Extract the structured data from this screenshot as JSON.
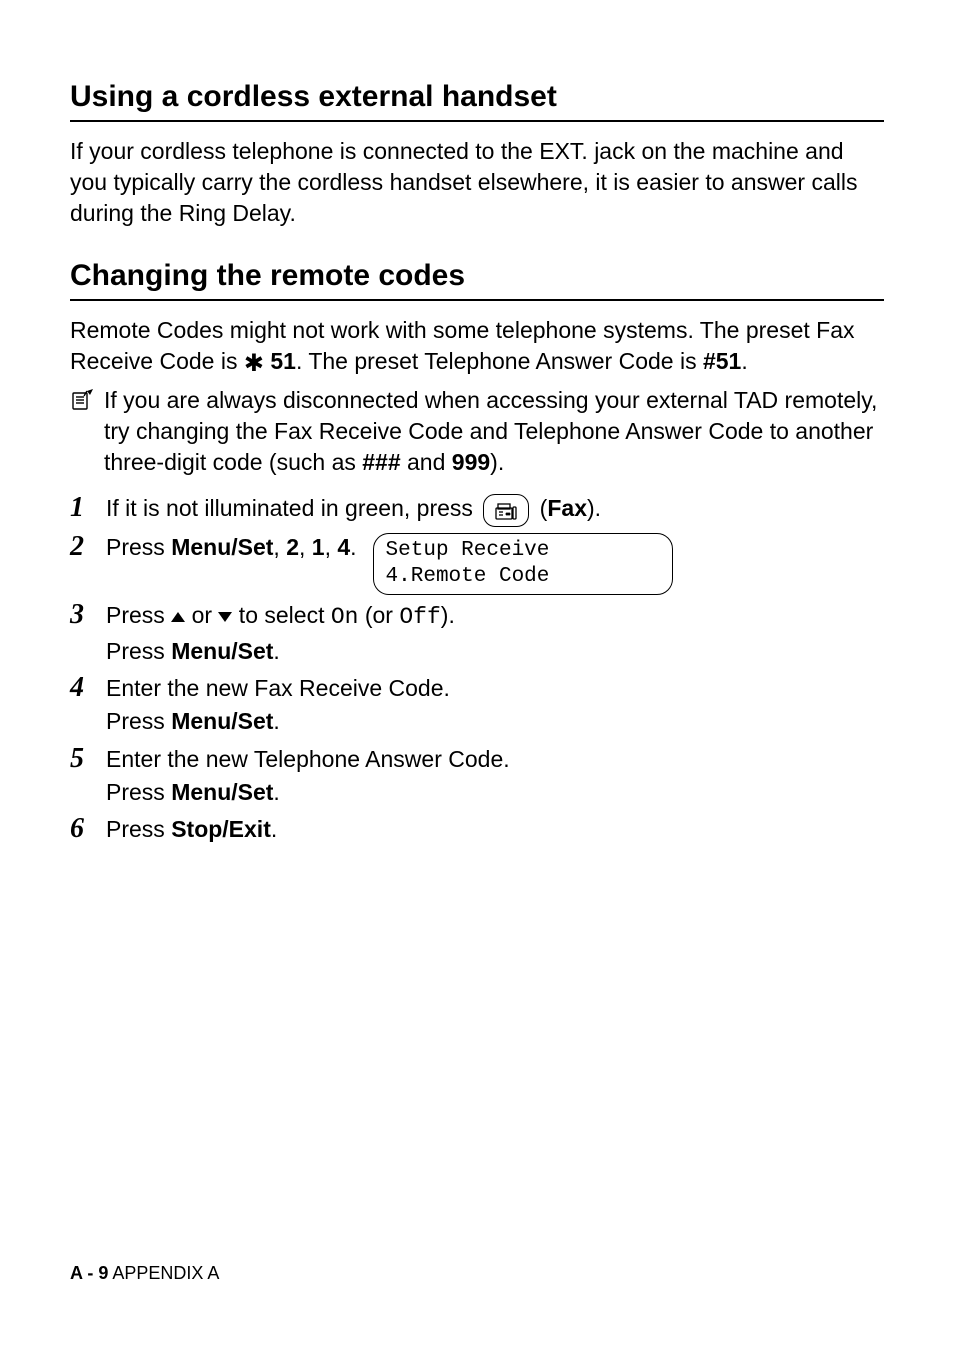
{
  "section1": {
    "title": "Using a cordless external handset",
    "para": "If your cordless telephone is connected to the EXT. jack on the machine and you typically carry the cordless handset elsewhere, it is easier to answer calls during the Ring Delay."
  },
  "section2": {
    "title": "Changing the remote codes",
    "para_prefix": "Remote Codes might not work with some telephone systems. The preset Fax Receive Code is ",
    "preset_fax_code_prefix_symbol": "✱",
    "preset_fax_code": " 51",
    "para_mid": ". The preset Telephone Answer Code is ",
    "preset_tel_code": "#51",
    "para_suffix": ".",
    "note_part1": "If you are always disconnected when accessing your external TAD remotely, try changing the Fax Receive Code and Telephone Answer Code to another three-digit code (such as ",
    "note_code1": "###",
    "note_and": " and ",
    "note_code2": "999",
    "note_part2": ")."
  },
  "steps": {
    "s1_a": "If it is not illuminated in green, press ",
    "s1_b": " (",
    "s1_fax": "Fax",
    "s1_c": ").",
    "s2_a": "Press ",
    "s2_menuset": "Menu/Set",
    "s2_b": ", ",
    "s2_k1": "2",
    "s2_k2": "1",
    "s2_k3": "4",
    "s2_c": ".",
    "s3_a": "Press ",
    "s3_b": " or ",
    "s3_c": " to select ",
    "s3_on": "On",
    "s3_d": " (or ",
    "s3_off": "Off",
    "s3_e": ").",
    "s3_f": "Press ",
    "s4_a": "Enter the new Fax Receive Code.",
    "s4_b": "Press ",
    "s5_a": "Enter the new Telephone Answer Code.",
    "s5_b": "Press ",
    "s6_a": "Press ",
    "s6_stop": "Stop/Exit",
    "s6_b": "."
  },
  "lcd": {
    "line1": "Setup Receive",
    "line2": "4.Remote Code"
  },
  "footer": {
    "page": "A - 9",
    "label": "   APPENDIX A"
  }
}
